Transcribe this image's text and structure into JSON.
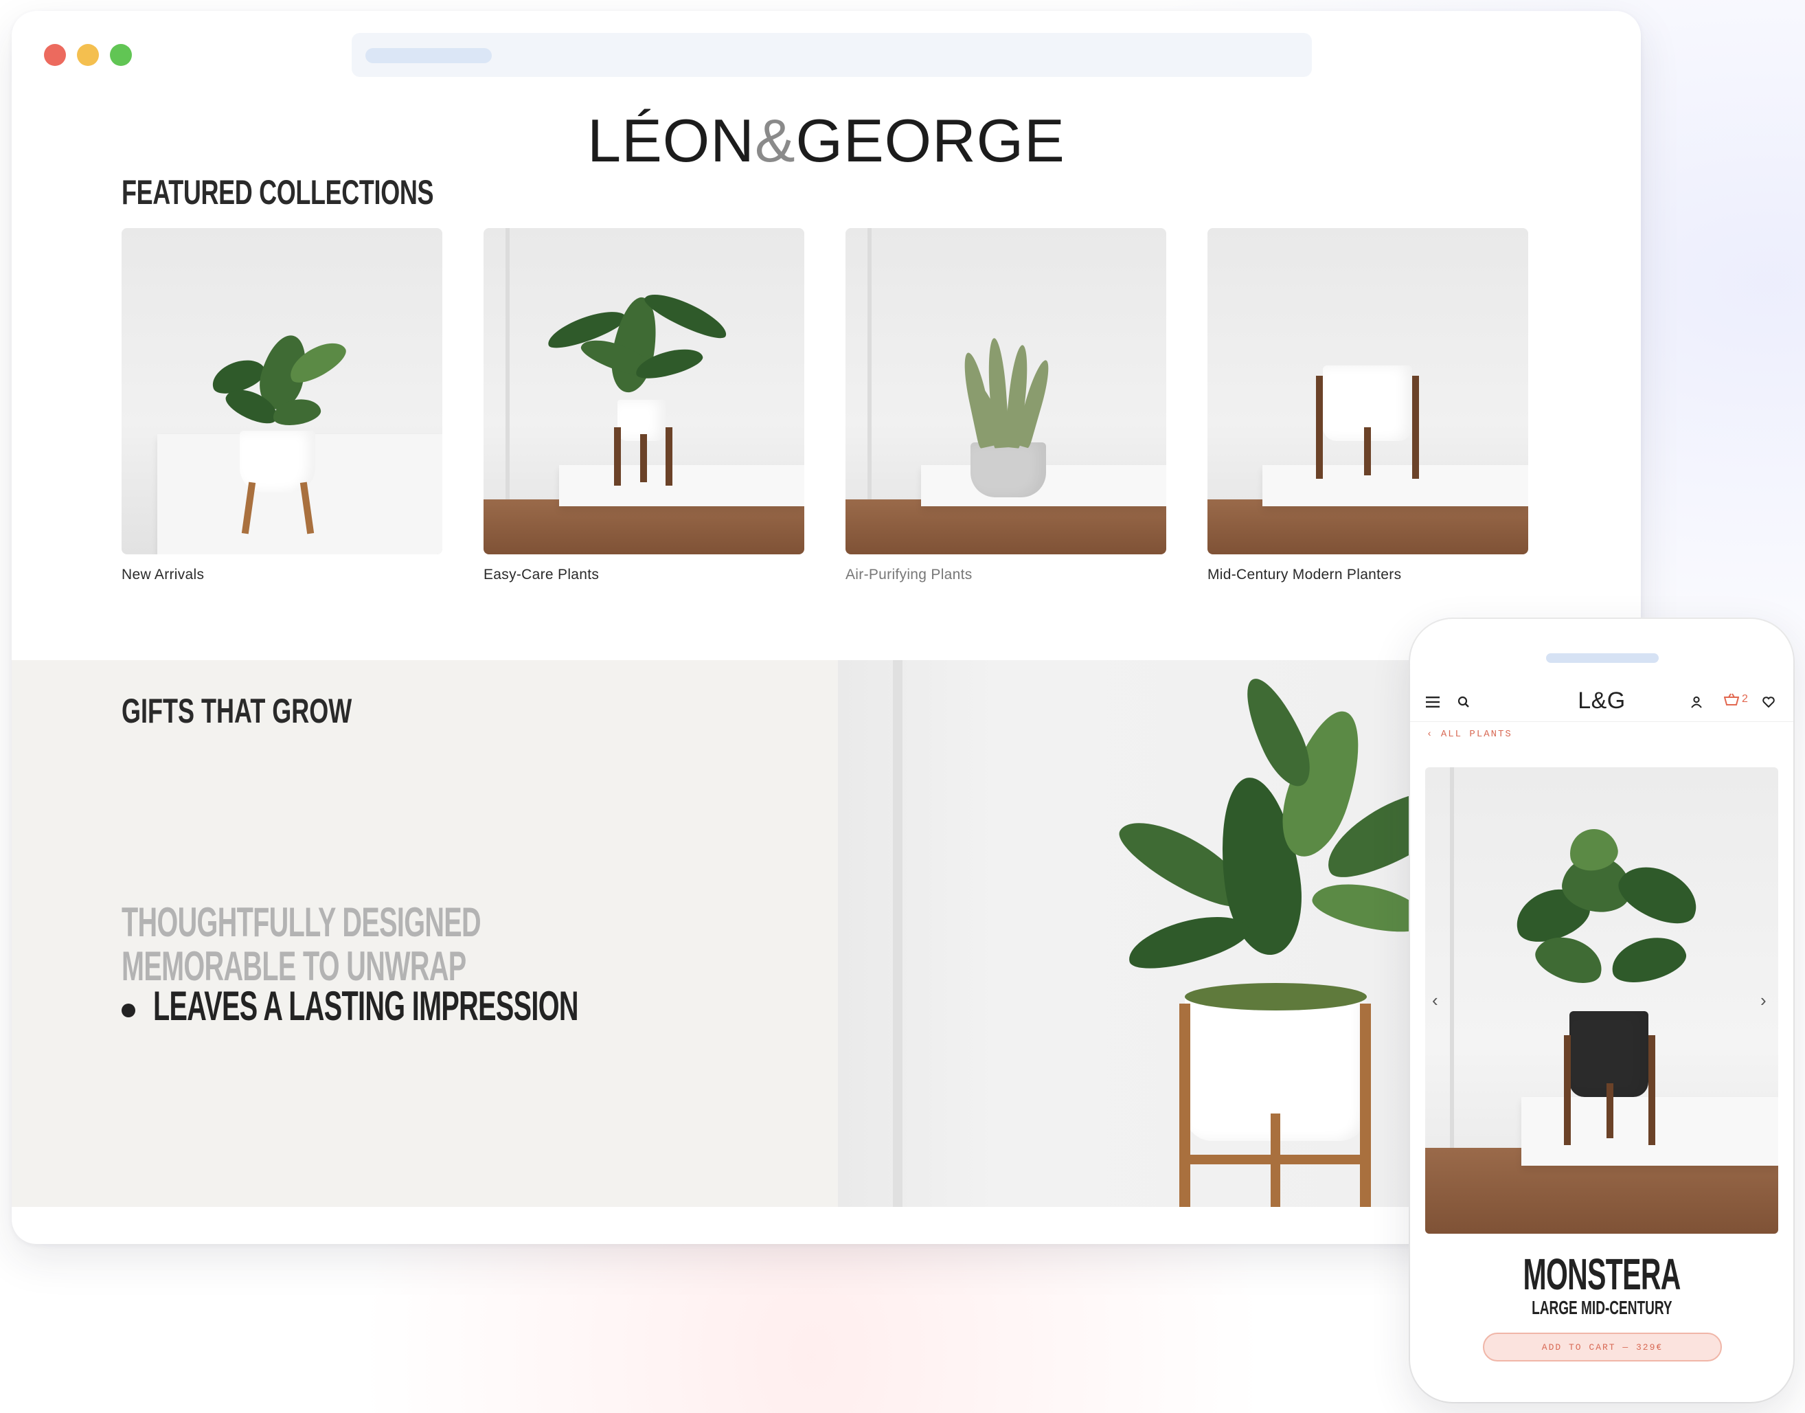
{
  "brand": {
    "name_left": "LÉON",
    "ampersand": "&",
    "name_right": "GEORGE",
    "short_logo": "L&G",
    "accent_color": "#d86a55"
  },
  "window_controls": [
    "close",
    "minimize",
    "maximize"
  ],
  "featured": {
    "title": "FEATURED COLLECTIONS",
    "collections": [
      {
        "label": "New Arrivals"
      },
      {
        "label": "Easy-Care Plants"
      },
      {
        "label": "Air-Purifying Plants"
      },
      {
        "label": "Mid-Century Modern Planters"
      }
    ]
  },
  "gifts": {
    "title": "GIFTS THAT GROW",
    "lines": [
      "THOUGHTFULLY DESIGNED",
      "MEMORABLE TO UNWRAP",
      "LEAVES A LASTING IMPRESSION"
    ],
    "active_line_index": 2
  },
  "mobile": {
    "nav_icons": [
      "menu-icon",
      "search-icon",
      "account-icon",
      "basket-icon",
      "heart-icon"
    ],
    "cart_count": "2",
    "back_link": "ALL PLANTS",
    "product_name": "MONSTERA",
    "product_variant": "LARGE MID-CENTURY",
    "add_to_cart": "ADD TO CART — 329€"
  }
}
